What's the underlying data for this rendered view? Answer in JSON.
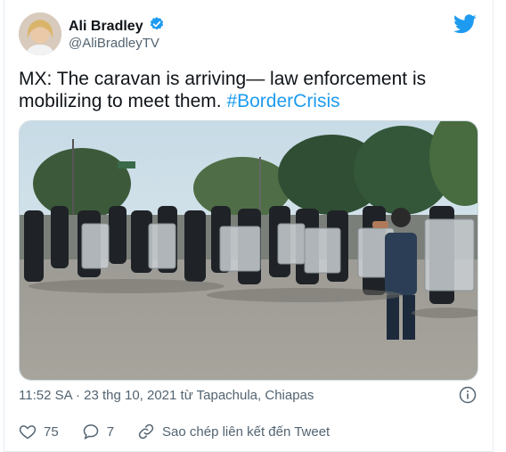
{
  "author": {
    "name": "Ali Bradley",
    "handle": "@AliBradleyTV",
    "verified": true
  },
  "tweet": {
    "text_main": "MX: The caravan is arriving— law enforcement is mobilizing to meet them. ",
    "hashtag": "#BorderCrisis"
  },
  "meta": {
    "timestamp": "11:52 SA · 23 thg 10, 2021 từ Tapachula, Chiapas"
  },
  "actions": {
    "likes": "75",
    "replies": "7",
    "copy_link_label": "Sao chép liên kết đến Tweet"
  },
  "colors": {
    "accent": "#1d9bf0",
    "text": "#0f1419",
    "secondary": "#536471"
  }
}
